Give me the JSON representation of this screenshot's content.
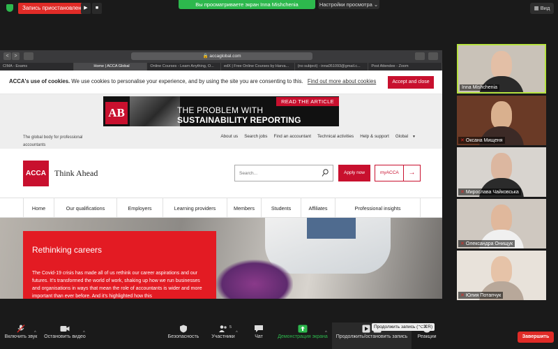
{
  "zoom_top": {
    "recording_status": "Запись приостановлена",
    "play_glyph": "▶",
    "stop_glyph": "■",
    "sharing_banner": "Вы просматриваете экран Inna Mishchenia",
    "view_settings": "Настройки просмотра ⌄",
    "view_button": "Вид",
    "view_icon": "grid-icon"
  },
  "browser": {
    "url": "accaglobal.com",
    "nav_back": "<",
    "nav_forward": ">",
    "tabs": [
      "CIMA - Exams",
      "Home | ACCA Global",
      "Online Courses - Learn Anything, O...",
      "edX | Free Online Courses by Harva...",
      "(no subject) - inna051093@gmail.c...",
      "Post Attendee - Zoom"
    ],
    "active_tab_index": 1
  },
  "site": {
    "cookie": {
      "title": "ACCA's use of cookies.",
      "text": "We use cookies to personalise your experience, and by using the site you are consenting to this.",
      "link": "Find out more about cookies",
      "accept": "Accept and close"
    },
    "ad": {
      "logo": "AB",
      "cta": "READ THE ARTICLE",
      "line1": "THE PROBLEM WITH",
      "line2": "SUSTAINABILITY REPORTING"
    },
    "tagline": "The global body for professional accountants",
    "util_links": [
      "About us",
      "Search jobs",
      "Find an accountant",
      "Technical activities",
      "Help & support",
      "Global"
    ],
    "util_caret": "▼",
    "logo_text": "ACCA",
    "brand_tagline": "Think Ahead",
    "search_placeholder": "Search...",
    "apply_now": "Apply now",
    "myacca": "myACCA",
    "myacca_arrow": "→",
    "nav": [
      {
        "label": "Home"
      },
      {
        "label": "Our qualifications"
      },
      {
        "label": "Employers"
      },
      {
        "label": "Learning providers"
      },
      {
        "label": "Members"
      },
      {
        "label": "Students"
      },
      {
        "label": "Affiliates"
      },
      {
        "label": "Professional insights"
      }
    ],
    "hero": {
      "title": "Rethinking careers",
      "text": "The Covid-19 crisis has made all of us rethink our career aspirations and our futures. It’s transformed the world of work, shaking up how we run businesses and organisations in ways that mean the role of accountants is wider and more important than ever before. And it’s highlighted how this"
    },
    "colors": {
      "acca_red": "#c8102e",
      "hero_red": "#e31b23"
    }
  },
  "participants": [
    {
      "name": "Inna Mishchenia",
      "muted": false,
      "active": true
    },
    {
      "name": "Оксана Мищеня",
      "muted": true,
      "active": false
    },
    {
      "name": "Мирослава Чайковська",
      "muted": true,
      "active": false
    },
    {
      "name": "Олександра Онищук",
      "muted": true,
      "active": false
    },
    {
      "name": "Юлия Потапчук",
      "muted": true,
      "active": false
    }
  ],
  "toolbar": {
    "unmute": "Включить звук",
    "start_video": "Остановить видео",
    "security": "Безопасность",
    "participants": "Участники",
    "participants_count": "5",
    "chat": "Чат",
    "share_screen": "Демонстрация экрана",
    "resume_stop_recording": "Продолжить/остановить запись",
    "reactions": "Реакции",
    "end": "Завершить",
    "tooltip": "Продолжить запись (⌥⌘R)",
    "caret": "^",
    "mic_off_icon": "mic-off-icon",
    "camera_icon": "camera-icon",
    "shield_icon": "shield-icon",
    "participants_icon": "people-icon",
    "chat_icon": "chat-bubble-icon",
    "share_icon": "share-screen-icon",
    "record_icon": "record-icon",
    "reactions_icon": "smiley-icon"
  }
}
